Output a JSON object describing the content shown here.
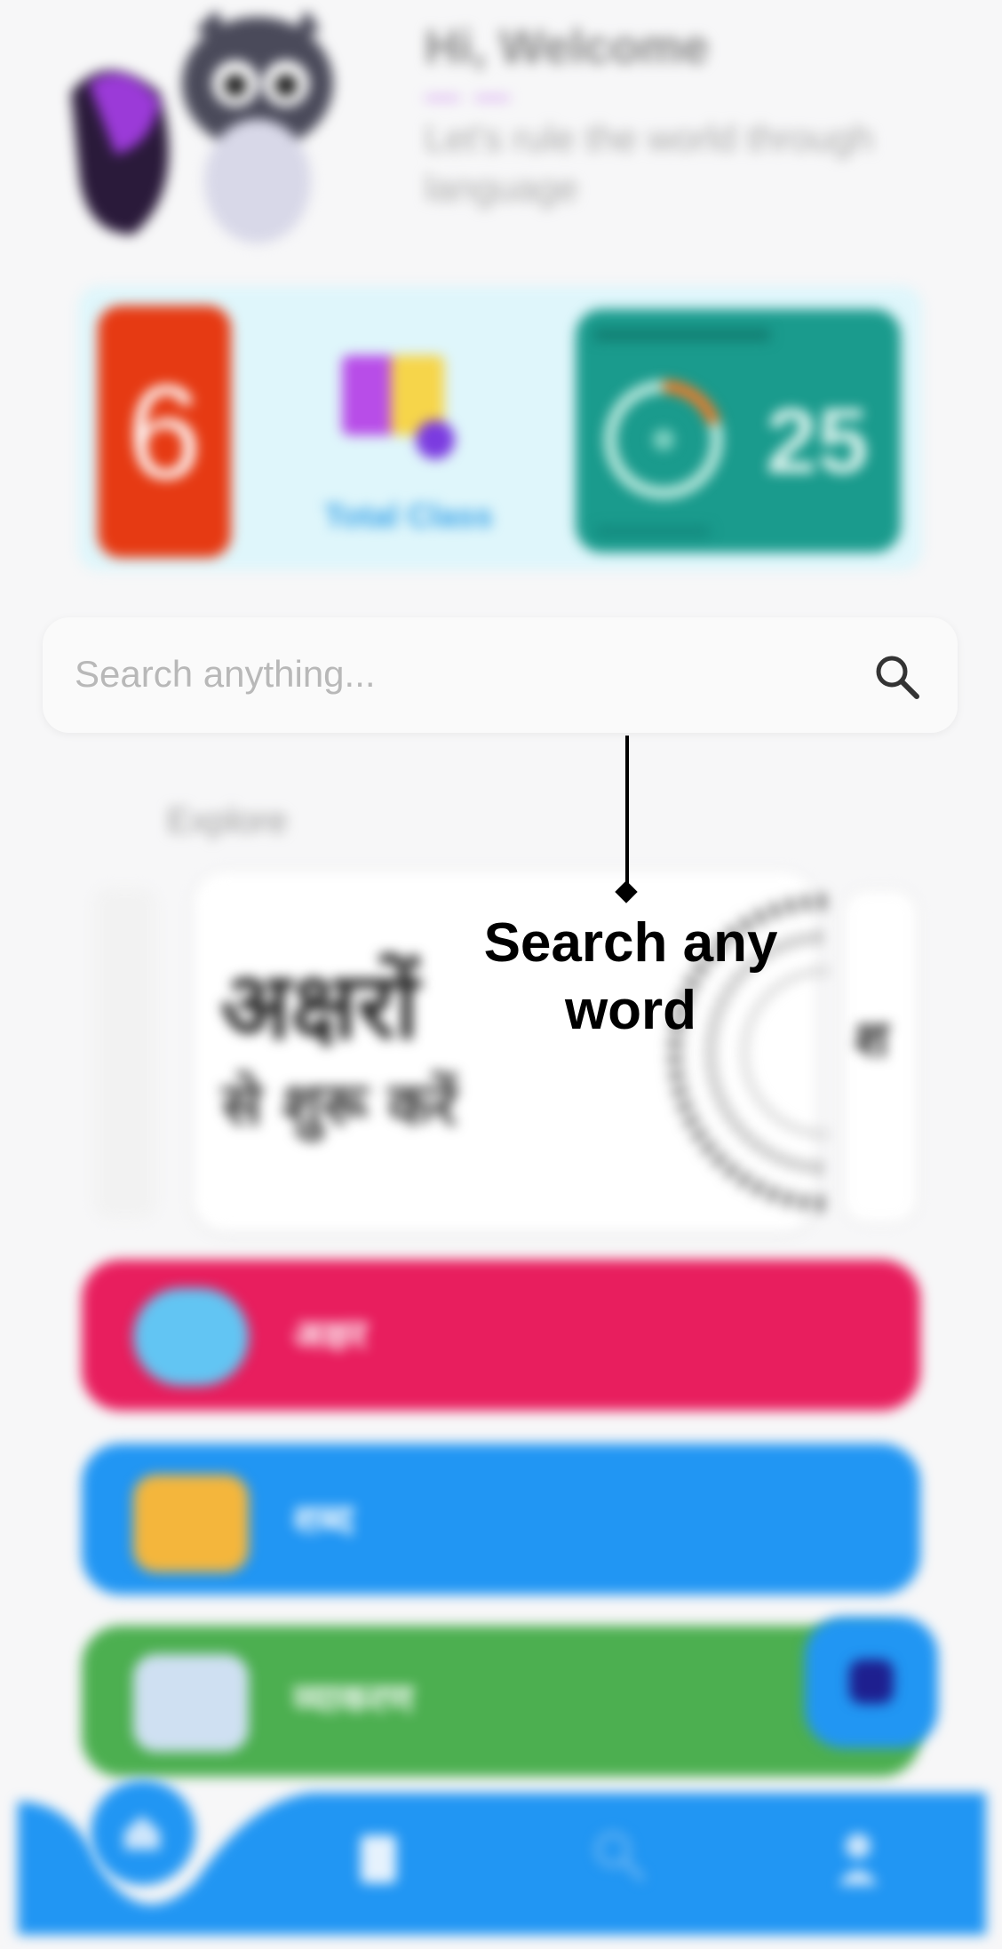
{
  "header": {
    "greeting": "Hi, Welcome",
    "subtitle": "Let's rule the world through language"
  },
  "stats": {
    "streak_value": "6",
    "total_class_label": "Total Class",
    "progress_value": "25",
    "progress_fraction": 0.2
  },
  "search": {
    "placeholder": "Search anything..."
  },
  "tooltip": {
    "text": "Search any word"
  },
  "explore": {
    "label": "Explore",
    "card_title": "अक्षरों",
    "card_subtitle": "से शुरू करें",
    "right_card_glyph": "श"
  },
  "categories": [
    {
      "label": "अक्षर",
      "color": "#e81e5e",
      "icon": "chat-bubble-icon"
    },
    {
      "label": "शब्द",
      "color": "#2196f3",
      "icon": "mail-icon"
    },
    {
      "label": "व्याकरण",
      "color": "#4caf50",
      "icon": "book-icon"
    }
  ],
  "nav": {
    "items": [
      "home-icon",
      "book-icon",
      "search-icon",
      "profile-icon"
    ],
    "accent": "#2196f3"
  }
}
